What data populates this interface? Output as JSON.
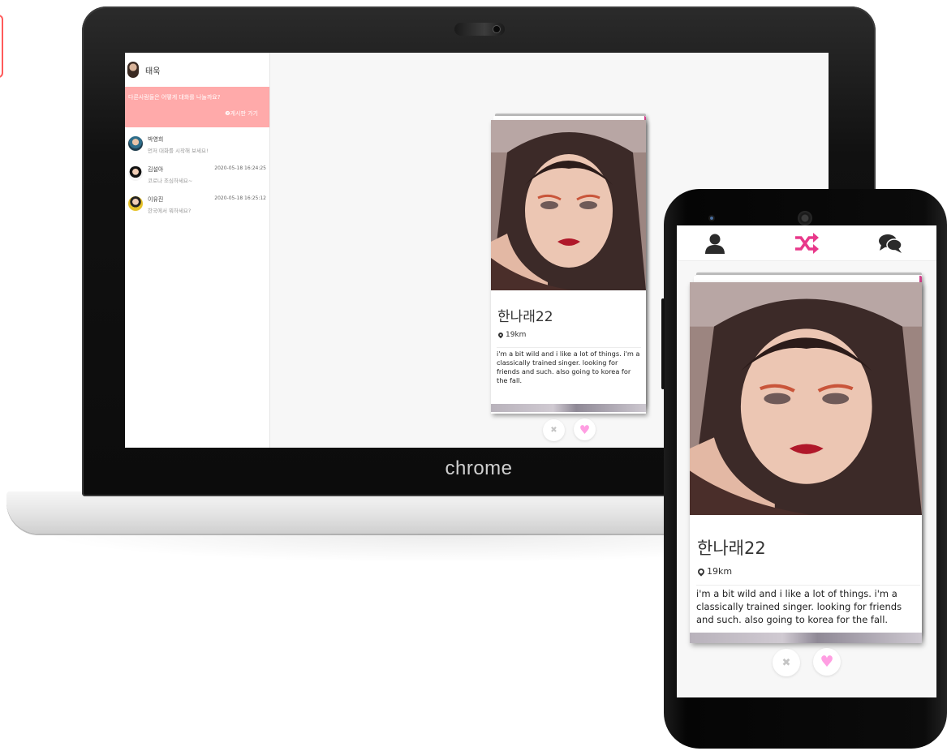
{
  "colors": {
    "accent_pink": "#e8388a",
    "banner_pink": "#ffaaaa",
    "like_pink": "#ff9ee2",
    "pass_gray": "#c5c5c5"
  },
  "laptop": {
    "brand": "chrome",
    "sidebar": {
      "user_name": "태욱",
      "banner_question": "다른사람들은 어떻게 대화를 나눌까요?",
      "banner_link": "❷게시판 가기",
      "chats": [
        {
          "name": "박영희",
          "time": "",
          "message": "먼저 대화를 시작해 보세요!"
        },
        {
          "name": "김설아",
          "time": "2020-05-18 16:24:25",
          "message": "코로나 조심하세요~"
        },
        {
          "name": "이유진",
          "time": "2020-05-18 16:25:12",
          "message": "한국에서 뭐하세요?"
        }
      ]
    }
  },
  "profile_card": {
    "name": "한나래22",
    "distance": "19km",
    "bio": "i'm a bit wild and i like a lot of things. i'm a classically trained singer. looking for friends and such. also going to korea for the fall."
  },
  "actions": {
    "pass_icon": "x-icon",
    "like_icon": "heart-icon",
    "pass_glyph": "✖",
    "like_glyph": "♥"
  },
  "phone": {
    "nav": [
      {
        "name": "profile-icon",
        "active": false
      },
      {
        "name": "shuffle-icon",
        "active": true
      },
      {
        "name": "chat-icon",
        "active": false
      }
    ]
  }
}
